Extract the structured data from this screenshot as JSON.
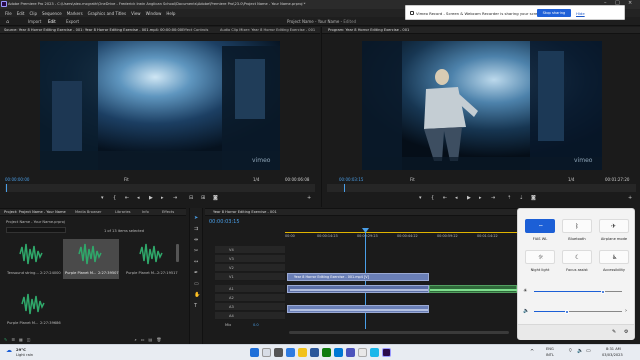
{
  "window": {
    "title": "Adobe Premiere Pro 2023 - C:\\Users\\alex.mcgrath\\OneDrive - Frederick Irwin Anglican School\\Documents\\Adobe\\Premiere Pro\\23.0\\Project Name - Your Name.prproj *"
  },
  "menu": [
    "File",
    "Edit",
    "Clip",
    "Sequence",
    "Markers",
    "Graphics and Titles",
    "View",
    "Window",
    "Help"
  ],
  "workspace_tabs": [
    "Import",
    "Edit",
    "Export"
  ],
  "project_title": {
    "name": "Project Name - Your Name",
    "status": "Edited"
  },
  "notification": {
    "text": "Vimeo Record - Screen & Webcam Recorder is sharing your screen.",
    "stop_label": "Stop sharing",
    "hide_label": "Hide"
  },
  "source_panel": {
    "tabs": [
      "Source: Year 8 Horror Editing Exercise - 001: Year 8 Horror Editing Exercise - 001.mp4: 00:00:00:00",
      "Effect Controls",
      "Audio Clip Mixer: Year 8 Horror Editing Exercise - 001"
    ],
    "timecode_left": "00:00:00:00",
    "fit": "Fit",
    "fraction": "1/4",
    "timecode_right": "00:00:06:08",
    "watermark": "vimeo"
  },
  "program_panel": {
    "tab": "Program: Year 8 Horror Editing Exercise - 001",
    "timecode_left": "00:00:03:15",
    "fit": "Fit",
    "fraction": "1/4",
    "timecode_right": "00:01:27:20",
    "watermark": "vimeo"
  },
  "project_panel": {
    "tabs": [
      "Project: Project Name - Your Name",
      "Media Browser",
      "Libraries",
      "Info",
      "Effects"
    ],
    "path": "Project Name - Your Name.prproj",
    "count": "1 of 13 items selected",
    "items": [
      {
        "name": "Tensound string...",
        "dur": "2:27:24000"
      },
      {
        "name": "Purple Planet M...",
        "dur": "2:27:39507"
      },
      {
        "name": "Purple Planet M...",
        "dur": "2:27:19517"
      },
      {
        "name": "Purple Planet M...",
        "dur": "2:27:39686"
      }
    ]
  },
  "timeline": {
    "tab": "Year 8 Horror Editing Exercise - 001",
    "timecode": "00:00:03:15",
    "video_tracks": [
      "V4",
      "V3",
      "V2",
      "V1"
    ],
    "audio_tracks": [
      "A1",
      "A2",
      "A3",
      "A4"
    ],
    "ruler_labels": [
      "00:00",
      "00:00:14:23",
      "00:00:29:23",
      "00:00:44:22",
      "00:00:59:22",
      "00:01:14:22"
    ],
    "clip_label": "Year 8 Horror Editing Exercise - 001.mp4 [V]",
    "audio_clip_label": "Purple Planet Music...",
    "mix_label": "Mix",
    "mix_value": "0.0"
  },
  "quick_settings": {
    "tiles": [
      {
        "label": "FIAS WL",
        "icon": "wifi-icon",
        "on": true
      },
      {
        "label": "Bluetooth",
        "icon": "bluetooth-icon",
        "on": false
      },
      {
        "label": "Airplane mode",
        "icon": "airplane-icon",
        "on": false
      },
      {
        "label": "Night light",
        "icon": "night-light-icon",
        "on": false
      },
      {
        "label": "Focus assist",
        "icon": "moon-icon",
        "on": false
      },
      {
        "label": "Accessibility",
        "icon": "accessibility-icon",
        "on": false
      }
    ],
    "brightness": 0.78,
    "volume": 0.37
  },
  "taskbar": {
    "weather_temp": "29°C",
    "weather_desc": "Light rain",
    "lang": "ENG",
    "region": "INTL",
    "time": "8:31 AM",
    "date": "03/03/2023"
  },
  "colors": {
    "accent": "#1c5fd6",
    "timecode": "#4a9fe8",
    "panel": "#1b1b1b"
  }
}
